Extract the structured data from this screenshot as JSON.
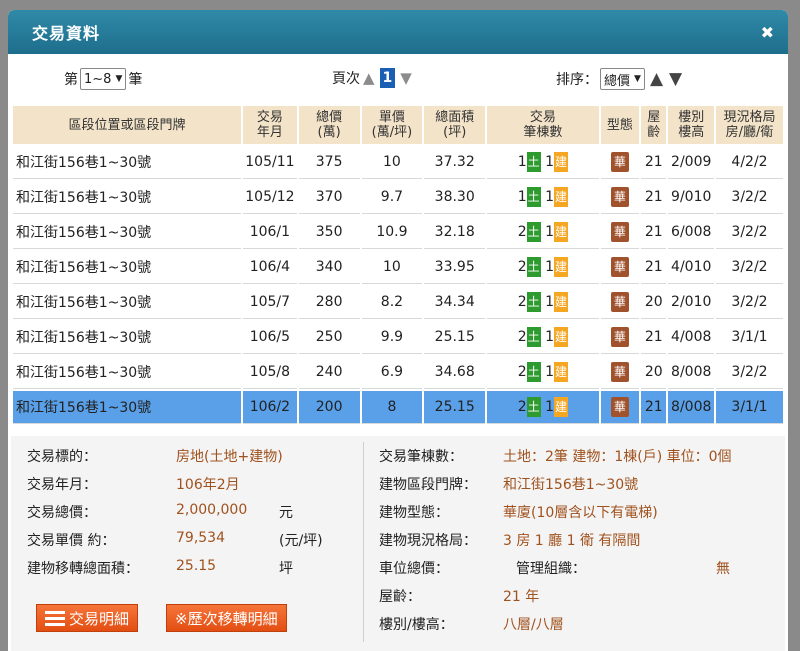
{
  "dialog": {
    "title": "交易資料",
    "close": "✖"
  },
  "controls": {
    "page_prefix": "第",
    "page_range": "1~8",
    "page_suffix": "筆",
    "nav_label": "頁次",
    "up_arrow": "▲",
    "current_page": "1",
    "down_arrow": "▼",
    "sort_label": "排序：",
    "sort_value": "總價",
    "sort_up": "▲",
    "sort_down": "▼"
  },
  "table": {
    "headers": [
      "區段位置或區段門牌",
      "交易\n年月",
      "總價\n(萬)",
      "單價\n(萬/坪)",
      "總面積\n(坪)",
      "交易\n筆棟數",
      "型態",
      "屋\n齡",
      "樓別\n樓高",
      "現況格局\n房/廳/衛"
    ],
    "land_badge": "土",
    "build_badge": "建",
    "type_badge": "華",
    "rows": [
      {
        "loc": "和江街156巷1~30號",
        "ym": "105/11",
        "total": "375",
        "unit": "10",
        "area": "37.32",
        "land": "1",
        "build": "1",
        "age": "21",
        "floor": "2/009",
        "layout": "4/2/2"
      },
      {
        "loc": "和江街156巷1~30號",
        "ym": "105/12",
        "total": "370",
        "unit": "9.7",
        "area": "38.30",
        "land": "1",
        "build": "1",
        "age": "21",
        "floor": "9/010",
        "layout": "3/2/2"
      },
      {
        "loc": "和江街156巷1~30號",
        "ym": "106/1",
        "total": "350",
        "unit": "10.9",
        "area": "32.18",
        "land": "2",
        "build": "1",
        "age": "21",
        "floor": "6/008",
        "layout": "3/2/2"
      },
      {
        "loc": "和江街156巷1~30號",
        "ym": "106/4",
        "total": "340",
        "unit": "10",
        "area": "33.95",
        "land": "2",
        "build": "1",
        "age": "21",
        "floor": "4/010",
        "layout": "3/2/2"
      },
      {
        "loc": "和江街156巷1~30號",
        "ym": "105/7",
        "total": "280",
        "unit": "8.2",
        "area": "34.34",
        "land": "2",
        "build": "1",
        "age": "20",
        "floor": "2/010",
        "layout": "3/2/2"
      },
      {
        "loc": "和江街156巷1~30號",
        "ym": "106/5",
        "total": "250",
        "unit": "9.9",
        "area": "25.15",
        "land": "2",
        "build": "1",
        "age": "21",
        "floor": "4/008",
        "layout": "3/1/1"
      },
      {
        "loc": "和江街156巷1~30號",
        "ym": "105/8",
        "total": "240",
        "unit": "6.9",
        "area": "34.68",
        "land": "2",
        "build": "1",
        "age": "20",
        "floor": "8/008",
        "layout": "3/2/2"
      },
      {
        "loc": "和江街156巷1~30號",
        "ym": "106/2",
        "total": "200",
        "unit": "8",
        "area": "25.15",
        "land": "2",
        "build": "1",
        "age": "21",
        "floor": "8/008",
        "layout": "3/1/1",
        "selected": true
      }
    ]
  },
  "detail": {
    "left": [
      {
        "label": "交易標的：",
        "value": "房地(土地+建物)",
        "unit": ""
      },
      {
        "label": "交易年月：",
        "value": "106年2月",
        "unit": ""
      },
      {
        "label": "交易總價：",
        "value": "2,000,000",
        "unit": "元"
      },
      {
        "label": "交易單價 約：",
        "value": "79,534",
        "unit": "(元/坪)"
      },
      {
        "label": "建物移轉總面積：",
        "value": "25.15",
        "unit": "坪"
      }
    ],
    "right": [
      {
        "label": "交易筆棟數：",
        "value": "土地：2筆 建物：1棟(戶) 車位：0個"
      },
      {
        "label": "建物區段門牌：",
        "value": "和江街156巷1~30號"
      },
      {
        "label": "建物型態：",
        "value": "華廈(10層含以下有電梯)"
      },
      {
        "label": "建物現況格局：",
        "value": "3 房 1 廳 1 衛 有隔間"
      },
      {
        "label": "車位總價：",
        "value": ""
      },
      {
        "label": "屋齡：",
        "value": "21 年"
      },
      {
        "label": "樓別/樓高：",
        "value": "八層/八層"
      }
    ],
    "mgmt_label": "管理組織：",
    "mgmt_value": "無",
    "btn_detail": "交易明細",
    "btn_history": "※歷次移轉明細"
  },
  "colors": {
    "title_bar": "#1d6e8c",
    "header_bg": "#f3e3c9",
    "selected_row": "#5aa0e8",
    "land_badge": "#2e9b2e",
    "build_badge": "#f5a623",
    "value_text": "#a0521e",
    "button": "#e34e12"
  }
}
